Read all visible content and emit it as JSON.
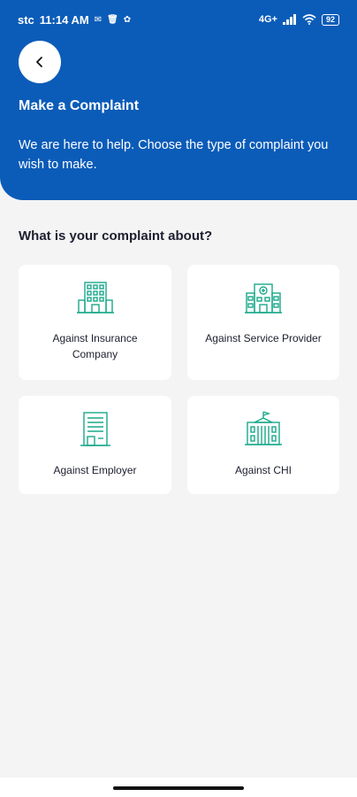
{
  "status_bar": {
    "carrier": "stc",
    "time": "11:14 AM",
    "network": "4G+",
    "battery": "92"
  },
  "header": {
    "title": "Make a Complaint",
    "subtitle": "We are here to help. Choose the type of complaint you wish to make."
  },
  "main": {
    "question": "What is your complaint about?",
    "options": [
      {
        "label": "Against Insurance Company",
        "icon": "office-building-icon"
      },
      {
        "label": "Against Service Provider",
        "icon": "hospital-icon"
      },
      {
        "label": "Against Employer",
        "icon": "employer-building-icon"
      },
      {
        "label": "Against CHI",
        "icon": "government-building-icon"
      }
    ]
  },
  "colors": {
    "header_bg": "#0b5cb8",
    "icon_accent": "#1aa98a",
    "page_bg": "#f4f4f5"
  }
}
